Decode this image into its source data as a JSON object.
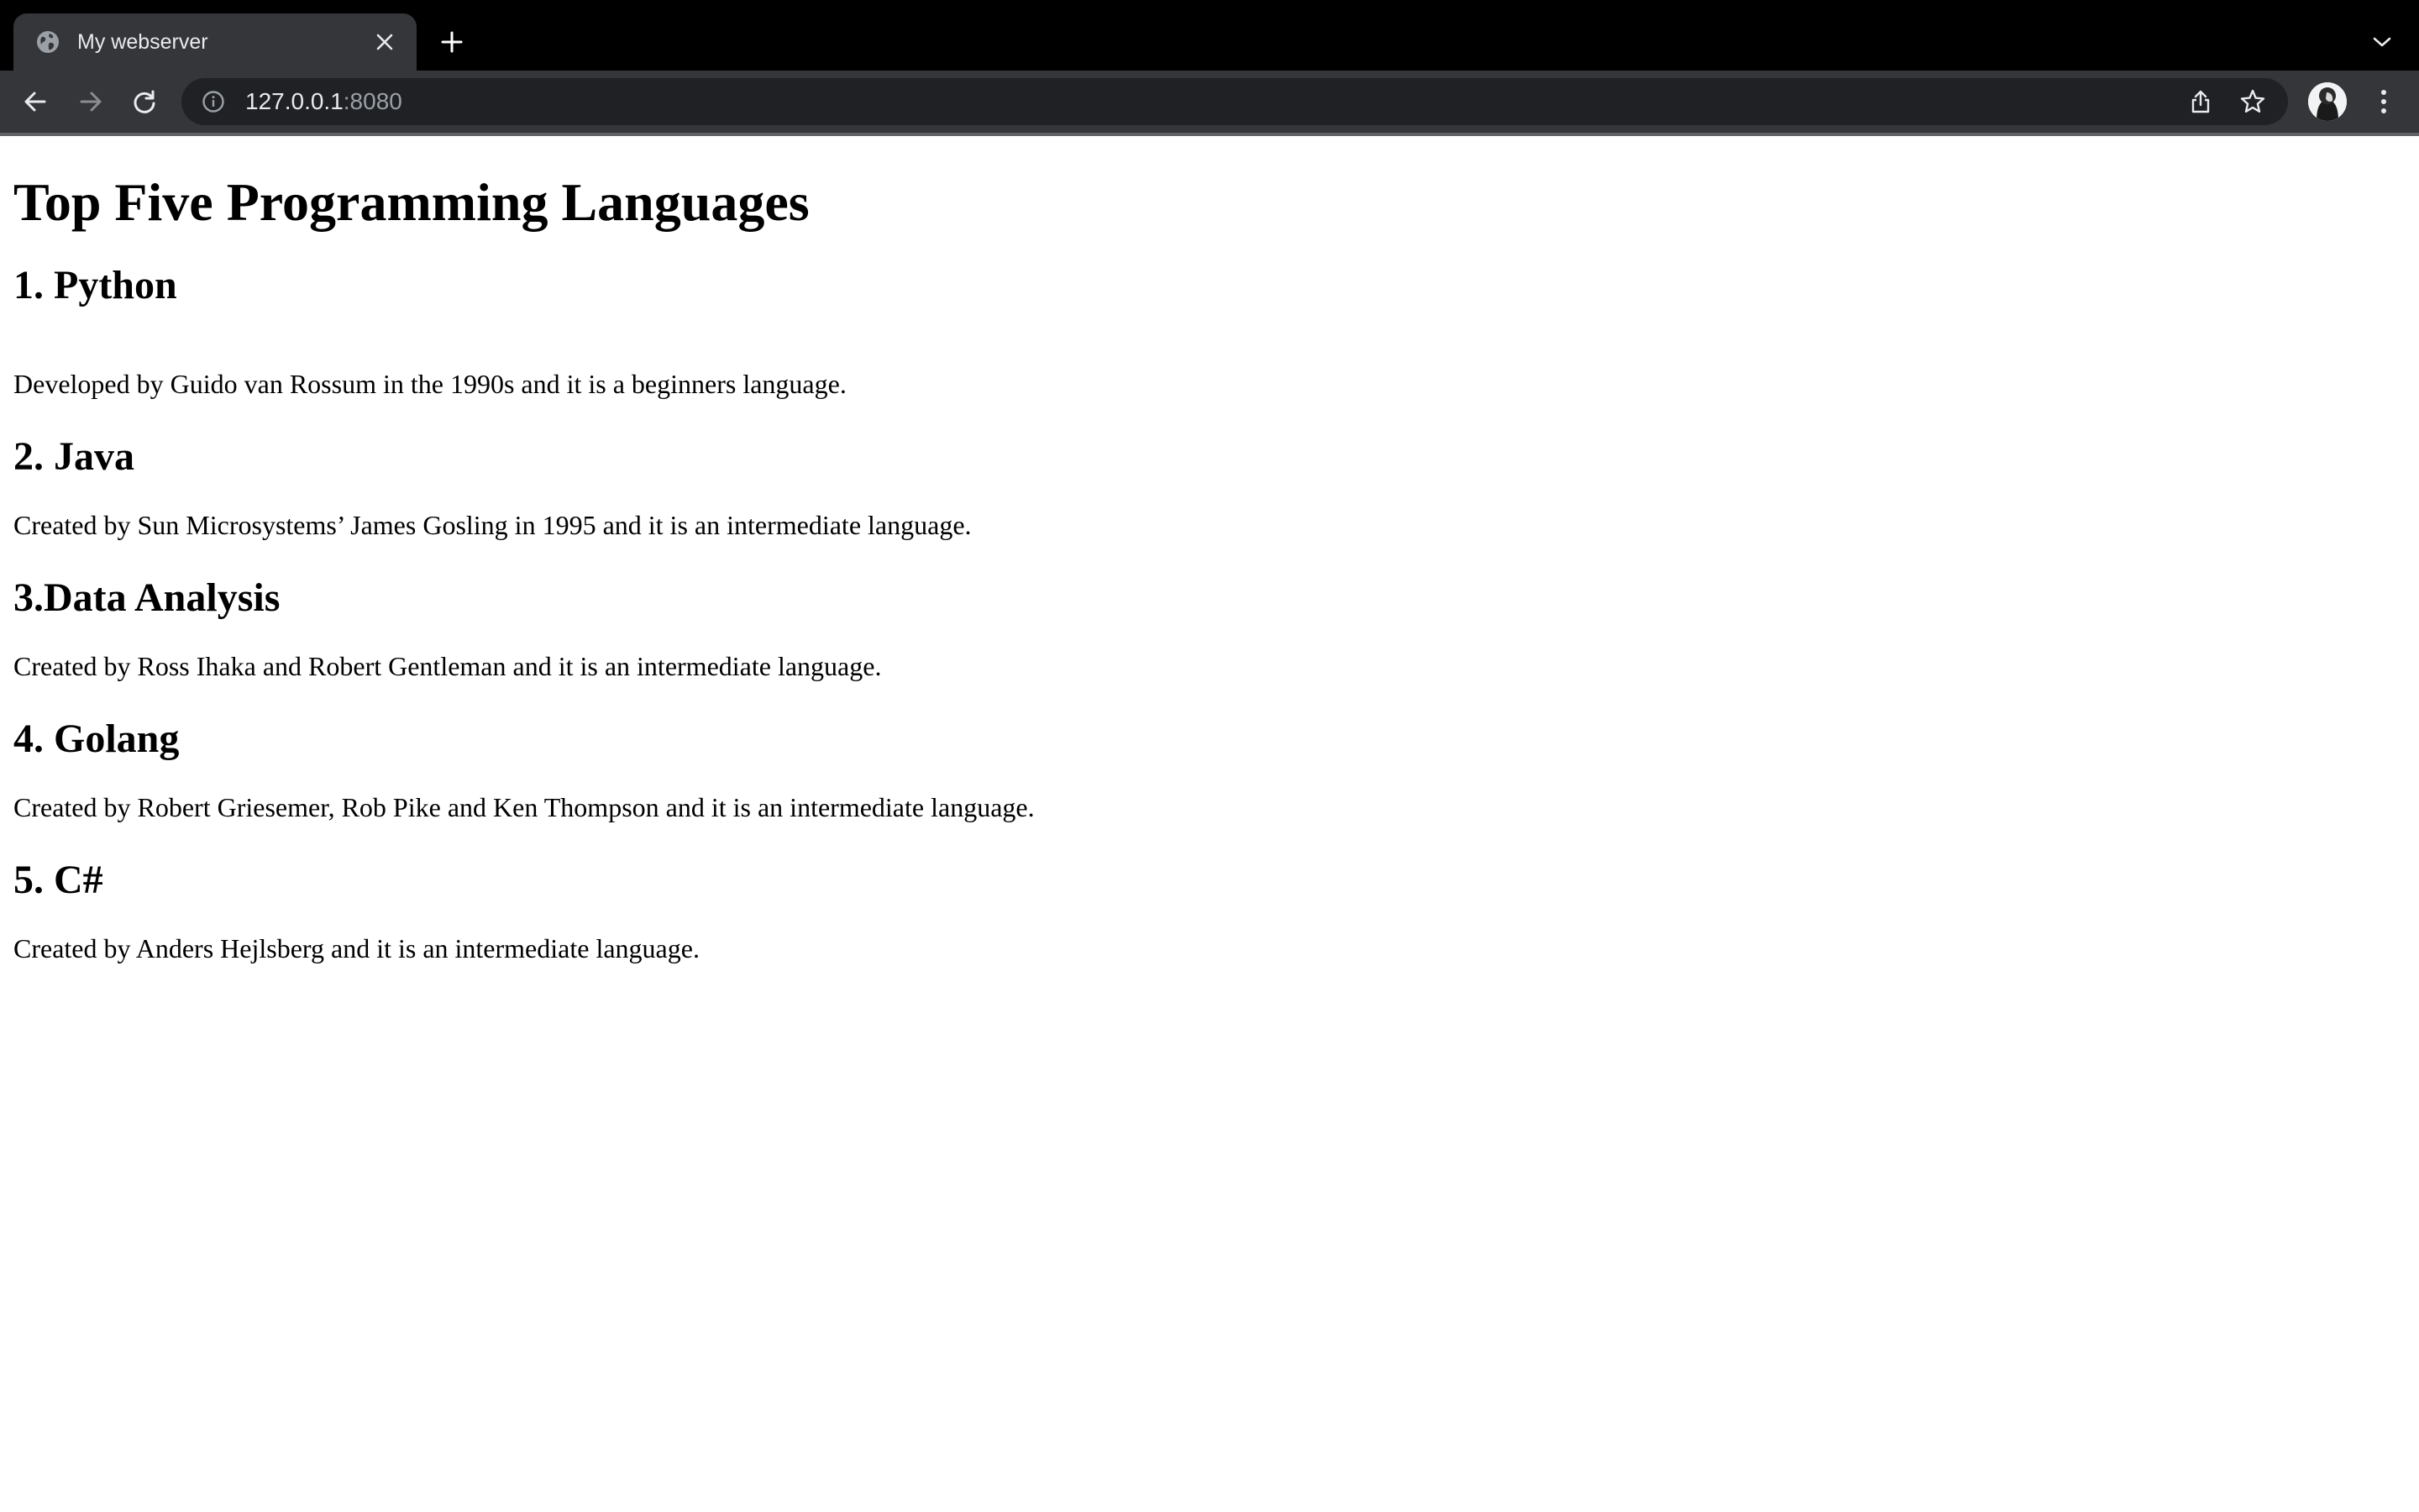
{
  "browser": {
    "tab": {
      "title": "My webserver",
      "favicon": "globe-icon"
    },
    "toolbar": {
      "url_host": "127.0.0.1",
      "url_port": ":8080"
    },
    "icons": {
      "back": "back-arrow-icon",
      "forward": "forward-arrow-icon",
      "reload": "reload-icon",
      "info": "info-icon",
      "share": "share-icon",
      "bookmark": "star-icon",
      "profile": "avatar",
      "menu": "kebab-menu-icon",
      "new_tab": "plus-icon",
      "tab_search": "chevron-down-icon"
    },
    "colors": {
      "tabstrip_bg": "#000000",
      "toolbar_bg": "#35363a",
      "omnibox_bg": "#202124",
      "text_light": "#e8eaed",
      "text_dim": "#9aa0a6"
    }
  },
  "page": {
    "heading": "Top Five Programming Languages",
    "sections": [
      {
        "title": "1. Python",
        "description": "Developed by Guido van Rossum in the 1990s and it is a beginners language."
      },
      {
        "title": "2. Java",
        "description": "Created by Sun Microsystems’ James Gosling in 1995 and it is an intermediate language."
      },
      {
        "title": "3.Data Analysis",
        "description": "Created by Ross Ihaka and Robert Gentleman and it is an intermediate language."
      },
      {
        "title": "4. Golang",
        "description": "Created by Robert Griesemer, Rob Pike and Ken Thompson and it is an intermediate language."
      },
      {
        "title": "5. C#",
        "description": "Created by Anders Hejlsberg and it is an intermediate language."
      }
    ]
  }
}
